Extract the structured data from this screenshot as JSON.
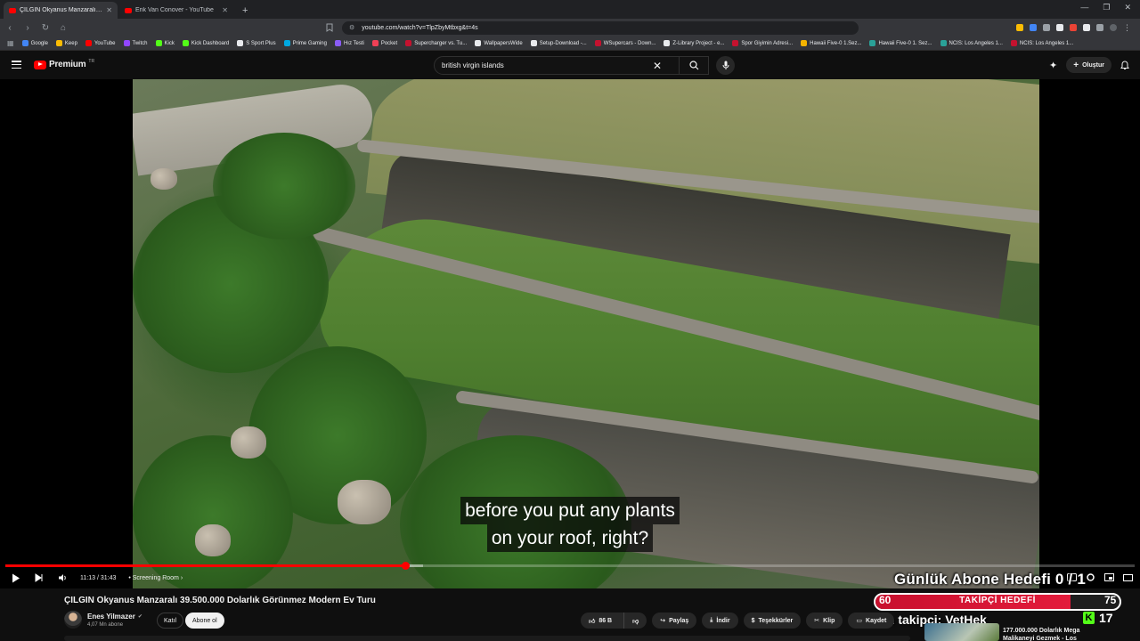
{
  "browser": {
    "tabs": [
      {
        "title": "ÇILGIN Okyanus Manzaralı 39.5",
        "active": true
      },
      {
        "title": "Erik Van Conover - YouTube",
        "active": false
      }
    ],
    "url": "youtube.com/watch?v=TlpZbyMtbxg&t=4s",
    "bookmarks": [
      {
        "label": "Google",
        "color": "#4285f4"
      },
      {
        "label": "Keep",
        "color": "#fbbc04"
      },
      {
        "label": "YouTube",
        "color": "#ff0000"
      },
      {
        "label": "Twitch",
        "color": "#9146ff"
      },
      {
        "label": "Kick",
        "color": "#53fc18"
      },
      {
        "label": "Kick Dashboard",
        "color": "#53fc18"
      },
      {
        "label": "S Sport Plus",
        "color": "#e8eaed"
      },
      {
        "label": "Prime Gaming",
        "color": "#00a8e1"
      },
      {
        "label": "Hız Testi",
        "color": "#8a5cf6"
      },
      {
        "label": "Pocket",
        "color": "#ef4056"
      },
      {
        "label": "Supercharger vs. Tu...",
        "color": "#c4122f"
      },
      {
        "label": "WallpapersWide",
        "color": "#e8eaed"
      },
      {
        "label": "Setup-Download -...",
        "color": "#e8eaed"
      },
      {
        "label": "WSupercars - Down...",
        "color": "#c4122f"
      },
      {
        "label": "Z-Library Project - e...",
        "color": "#e8eaed"
      },
      {
        "label": "Spor Giyimin Adresi...",
        "color": "#c4122f"
      },
      {
        "label": "Hawaii Five-0 1.Sez...",
        "color": "#f5b400"
      },
      {
        "label": "Hawaii Five-0 1. Sez...",
        "color": "#2aa198"
      },
      {
        "label": "NCIS: Los Angeles 1...",
        "color": "#2aa198"
      },
      {
        "label": "NCIS: Los Angeles 1...",
        "color": "#c4122f"
      }
    ]
  },
  "youtube": {
    "logo_text": "Premium",
    "region": "TR",
    "search_value": "british virgin islands",
    "create_label": "Oluştur"
  },
  "player": {
    "caption_line1": "before you put any plants",
    "caption_line2": "on your roof, right?",
    "current_time": "11:13",
    "duration": "31:43",
    "time_text": "11:13 / 31:43",
    "chapter": "• Screening Room",
    "progress_fraction": 0.3538,
    "buffered_fraction": 0.37
  },
  "overlay": {
    "goal_title": "Günlük Abone Hedefi 0 / 1",
    "goal_left": "60",
    "goal_label": "TAKİPÇİ HEDEFİ",
    "goal_right": "75",
    "goal_fraction": 0.8,
    "last_follower": "Son takipçi: VetHek",
    "kick_count": "17"
  },
  "video": {
    "title": "ÇILGIN Okyanus Manzaralı 39.500.000 Dolarlık Görünmez Modern Ev Turu",
    "channel": "Enes Yilmazer",
    "subscribers": "4,07 Mn abone",
    "join_label": "Katıl",
    "subscribe_label": "Abone ol",
    "likes": "86 B",
    "share_label": "Paylaş",
    "download_label": "İndir",
    "thanks_label": "Teşekkürler",
    "clip_label": "Klip",
    "save_label": "Kaydet"
  },
  "sidebar": {
    "next_title": "177.000.000 Dolarlık Mega Malikaneyi Gezmek - Los"
  }
}
